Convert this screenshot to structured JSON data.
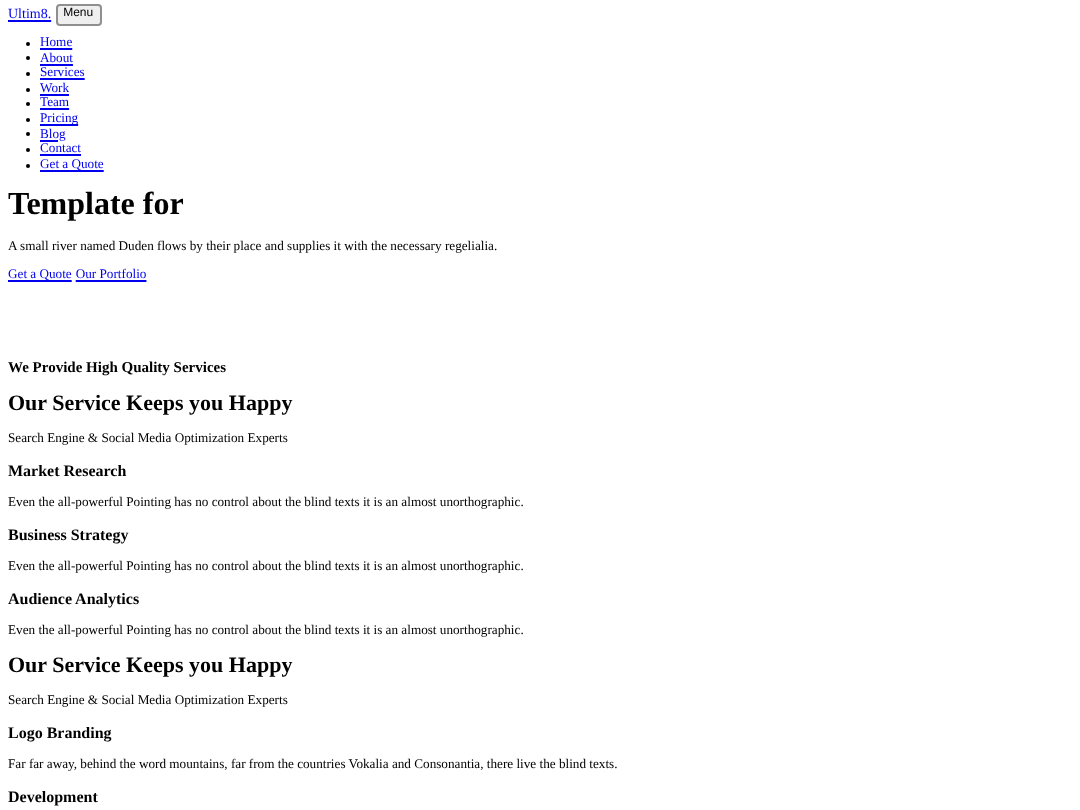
{
  "header": {
    "brand": "Ultim8.",
    "menu_button": "Menu"
  },
  "nav": {
    "items": [
      {
        "label": "Home"
      },
      {
        "label": "About"
      },
      {
        "label": "Services"
      },
      {
        "label": "Work"
      },
      {
        "label": "Team"
      },
      {
        "label": "Pricing"
      },
      {
        "label": "Blog"
      },
      {
        "label": "Contact"
      },
      {
        "label": "Get a Quote"
      }
    ]
  },
  "hero": {
    "title": "Template for",
    "text": "A small river named Duden flows by their place and supplies it with the necessary regelialia.",
    "links": [
      "Get a Quote",
      "Our Portfolio"
    ]
  },
  "content": [
    {
      "kind": "eyebrow",
      "text": "We Provide High Quality Services"
    },
    {
      "kind": "heading",
      "text": "Our Service Keeps you Happy"
    },
    {
      "kind": "subtitle",
      "text": "Search Engine & Social Media Optimization Experts"
    },
    {
      "kind": "item_title",
      "text": "Market Research"
    },
    {
      "kind": "item_text",
      "text": "Even the all-powerful Pointing has no control about the blind texts it is an almost unorthographic."
    },
    {
      "kind": "item_title",
      "text": "Business Strategy"
    },
    {
      "kind": "item_text",
      "text": "Even the all-powerful Pointing has no control about the blind texts it is an almost unorthographic."
    },
    {
      "kind": "item_title",
      "text": "Audience Analytics"
    },
    {
      "kind": "item_text",
      "text": "Even the all-powerful Pointing has no control about the blind texts it is an almost unorthographic."
    },
    {
      "kind": "heading",
      "text": "Our Service Keeps you Happy"
    },
    {
      "kind": "subtitle",
      "text": "Search Engine & Social Media Optimization Experts"
    },
    {
      "kind": "item_title",
      "text": "Logo Branding"
    },
    {
      "kind": "item_text",
      "text": "Far far away, behind the word mountains, far from the countries Vokalia and Consonantia, there live the blind texts."
    },
    {
      "kind": "item_title",
      "text": "Development"
    }
  ]
}
